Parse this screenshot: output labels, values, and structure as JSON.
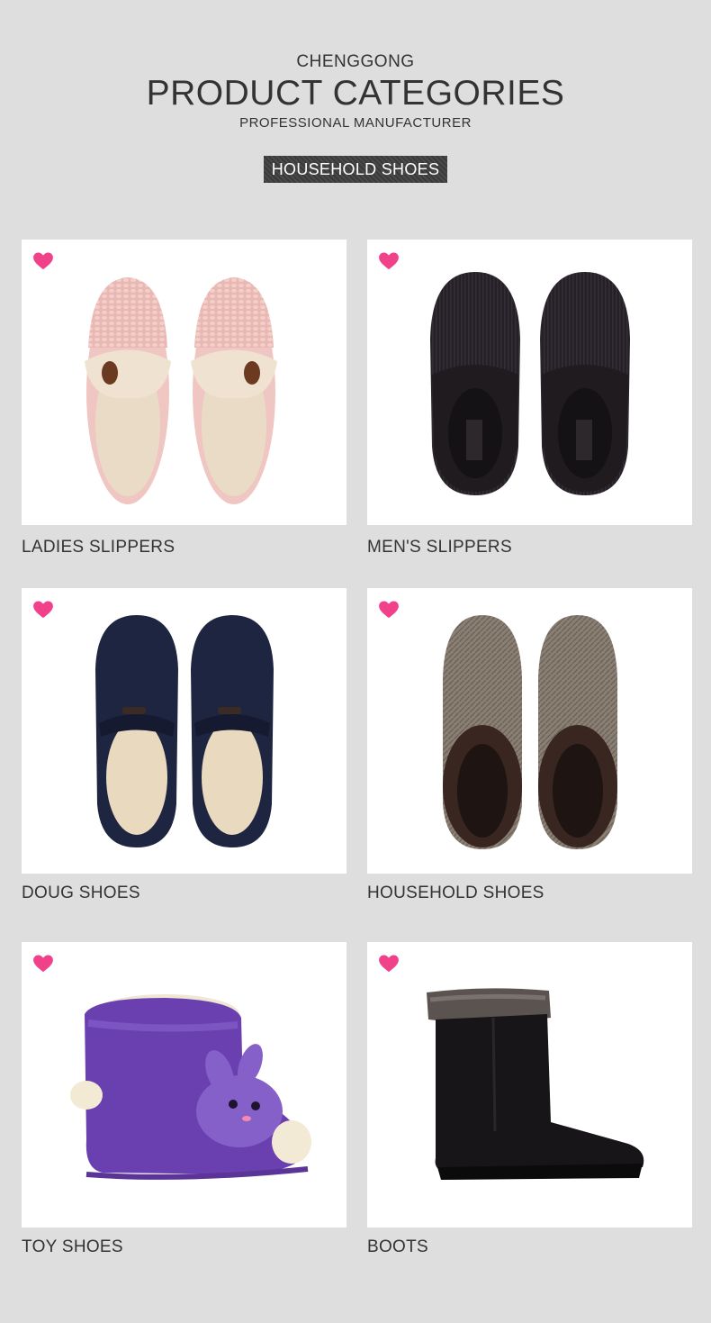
{
  "header": {
    "brand": "CHENGGONG",
    "title": "PRODUCT CATEGORIES",
    "subtitle": "PROFESSIONAL MANUFACTURER",
    "tag": "HOUSEHOLD SHOES"
  },
  "products": [
    {
      "label": "LADIES SLIPPERS",
      "icon": "heart-icon",
      "image": "pink-knit-slippers-image"
    },
    {
      "label": "MEN'S SLIPPERS",
      "icon": "heart-icon",
      "image": "black-corduroy-slippers-image"
    },
    {
      "label": "DOUG SHOES",
      "icon": "heart-icon",
      "image": "navy-moccasins-image"
    },
    {
      "label": "HOUSEHOLD SHOES",
      "icon": "heart-icon",
      "image": "tweed-slippers-image"
    },
    {
      "label": "TOY SHOES",
      "icon": "heart-icon",
      "image": "purple-plush-bootie-image"
    },
    {
      "label": "BOOTS",
      "icon": "heart-icon",
      "image": "black-suede-boot-image"
    }
  ],
  "colors": {
    "background": "#dedede",
    "heart": "#f0418a",
    "text": "#333333",
    "tag_bg": "#404040"
  }
}
